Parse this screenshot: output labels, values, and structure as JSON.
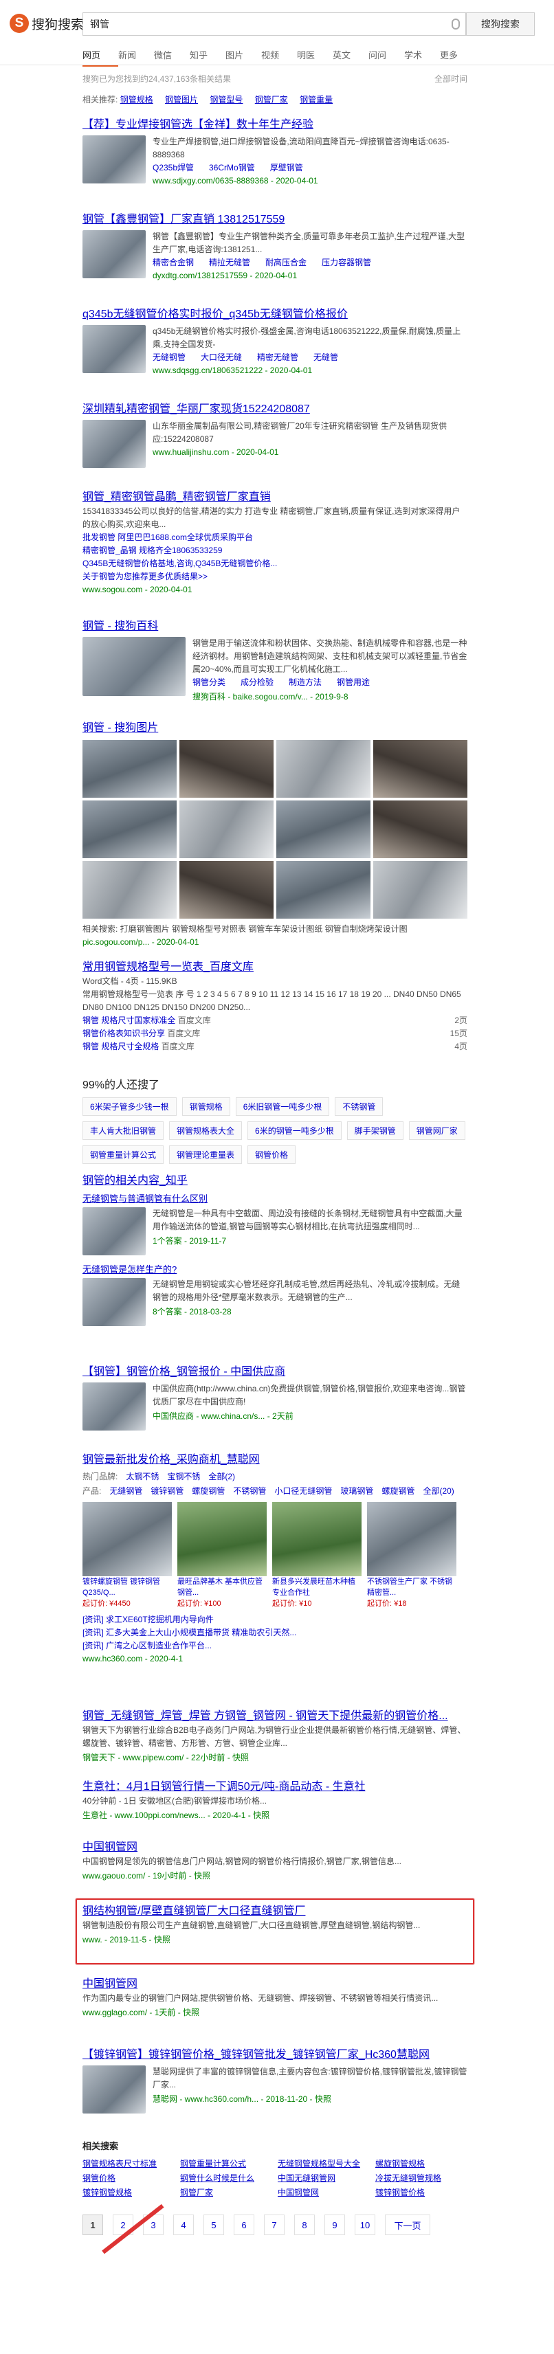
{
  "logo": {
    "mark": "S",
    "text": "搜狗搜索"
  },
  "search": {
    "value": "钢管",
    "button": "搜狗搜索"
  },
  "tabs": [
    "网页",
    "新闻",
    "微信",
    "知乎",
    "图片",
    "视频",
    "明医",
    "英文",
    "问问",
    "学术",
    "更多"
  ],
  "info": {
    "count": "搜狗已为您找到约24,437,163条相关结果",
    "tools": "全部时间"
  },
  "related_top": {
    "label": "相关推荐:",
    "items": [
      "钢管规格",
      "钢管图片",
      "钢管型号",
      "钢管厂家",
      "钢管重量"
    ]
  },
  "results": [
    {
      "title": "【荐】专业焊接钢管选【金祥】数十年生产经验",
      "text": "专业生产焊接钢管,进口焊接钢管设备,流动阳间直降百元~焊接钢管咨询电话:0635-8889368",
      "links": [
        "Q235b焊管",
        "36CrMo钢管",
        "厚壁钢管"
      ],
      "url": "www.sdjxgy.com/0635-8889368 - 2020-04-01"
    },
    {
      "title": "钢管【鑫豐钢管】厂家直销 13812517559",
      "text": "钢管【鑫豐钢管】专业生产钢管种类齐全,质量可靠多年老员工监护,生产过程严谨,大型生产厂家,电话咨询:1381251...",
      "links": [
        "精密合金钢",
        "精拉无缝管",
        "耐高压合金",
        "压力容器钢管"
      ],
      "url": "dyxdtg.com/13812517559 - 2020-04-01"
    },
    {
      "title": "q345b无缝钢管价格实时报价_q345b无缝钢管价格报价",
      "text": "q345b无缝钢管价格实时报价-强盛金属,咨询电话18063521222,质量保,耐腐蚀,质量上乘,支持全国发货-",
      "links": [
        "无缝钢管",
        "大口径无缝",
        "精密无缝管",
        "无缝管"
      ],
      "url": "www.sdqsgg.cn/18063521222 - 2020-04-01"
    },
    {
      "title": "深圳精轧精密钢管_华丽厂家现货15224208087",
      "text": "山东华丽金属制品有限公司,精密钢管厂20年专注研究精密钢管 生产及销售现货供应:15224208087",
      "url": "www.hualijinshu.com - 2020-04-01"
    }
  ],
  "sogou_result": {
    "title": "钢管_精密钢管晶鹏_精密钢管厂家直销",
    "text": "15341833345公司以良好的信誉,精湛的实力 打造专业 精密钢管,厂家直销,质量有保证,选到对家深得用户的放心购买,欢迎来电...",
    "lines": [
      "批发钢管 阿里巴巴1688.com全球优质采购平台",
      "精密钢管_晶钢 规格齐全18063533259",
      "Q345B无缝钢管价格基地,咨询,Q345B无缝钢管价格...",
      "关于钢管为您推荐更多优质结果>>"
    ],
    "url": "www.sogou.com - 2020-04-01"
  },
  "baike": {
    "title": "钢管 - 搜狗百科",
    "text": "钢管是用于输送流体和粉状固体、交换热能、制造机械零件和容器,也是一种经济钢材。用钢管制造建筑结构网架、支柱和机械支架可以减轻重量,节省金属20~40%,而且可实现工厂化机械化施工...",
    "links": [
      "钢管分类",
      "成分检验",
      "制造方法",
      "钢管用途"
    ],
    "url": "搜狗百科 - baike.sogou.com/v... - 2019-9-8"
  },
  "images": {
    "title": "钢管 - 搜狗图片",
    "related": "相关搜索: 打磨钢管图片  钢管规格型号对照表  钢管车车架设计图纸  钢管自制烧烤架设计图",
    "url": "pic.sogou.com/p... - 2020-04-01"
  },
  "wenku": {
    "title": "常用钢管规格型号一览表_百度文库",
    "meta": "Word文档 - 4页 - 115.9KB",
    "text": "常用钢管规格型号一览表 序 号 1 2 3 4 5 6 7 8 9 10 11 12 13 14 15 16 17 18 19 20 ... DN40 DN50 DN65 DN80 DN100 DN125 DN150 DN200 DN250...",
    "docs": [
      {
        "name": "钢管 规格尺寸国家标准全",
        "src": "百度文库",
        "pages": "2页"
      },
      {
        "name": "钢管价格表知识书分享",
        "src": "百度文库",
        "pages": "15页"
      },
      {
        "name": "钢管 规格尺寸全规格",
        "src": "百度文库",
        "pages": "4页"
      }
    ]
  },
  "also_ask": {
    "title": "99%的人还搜了",
    "items": [
      "6米架子管多少钱一根",
      "钢管规格",
      "6米旧钢管一吨多少根",
      "不锈钢管",
      "丰人肯大批旧钢管",
      "钢管规格表大全",
      "6米的钢管一吨多少根",
      "脚手架钢管",
      "钢管网厂家",
      "钢管重量计算公式",
      "钢管理论重量表",
      "钢管价格"
    ]
  },
  "zhihu": {
    "title": "钢管的相关内容_知乎",
    "q1": "无缝钢管与普通钢管有什么区别",
    "t1": "无缝钢管是一种具有中空截面、周边没有接缝的长条钢材,无缝钢管具有中空截面,大量用作输送流体的管道,钢管与圆钢等实心钢材相比,在抗弯抗扭强度相同时...",
    "m1": "1个答案 - 2019-11-7",
    "q2": "无缝钢管是怎样生产的?",
    "t2": "无缝钢管是用钢锭或实心管坯经穿孔制成毛管,然后再经热轧、冷轧或冷拔制成。无缝钢管的规格用外径*壁厚毫米数表示。无缝钢管的生产...",
    "m2": "8个答案 - 2018-03-28"
  },
  "china_cn": {
    "title": "【钢管】钢管价格_钢管报价 - 中国供应商",
    "text": "中国供应商(http://www.china.cn)免费提供钢管,钢管价格,钢管报价,欢迎来电咨询...钢管优质厂家尽在中国供应商!",
    "url": "中国供应商 - www.china.cn/s... - 2天前"
  },
  "hc360": {
    "title": "钢管最新批发价格_采购商机_慧聪网",
    "filter_label": "热门品牌:",
    "filter": [
      "太钢不锈",
      "宝钢不锈",
      "全部(2)"
    ],
    "filter2_label": "产品:",
    "filter2": [
      "无缝钢管",
      "镀锌钢管",
      "螺旋钢管",
      "不锈钢管",
      "小口径无缝钢管",
      "玻璃钢管",
      "螺旋钢管",
      "全部(20)"
    ],
    "products": [
      {
        "name": "镀锌螺旋钢管 镀锌钢管Q235/Q...",
        "price": "起订价: ¥4450"
      },
      {
        "name": "最旺品牌基木 基本供应管 钢管...",
        "price": "起订价: ¥100"
      },
      {
        "name": "新县多兴发晨旺苗木种植专业合作社",
        "price": "起订价: ¥10"
      },
      {
        "name": "不锈钢管生产厂家 不锈钢精密管...",
        "price": "起订价: ¥18"
      }
    ],
    "links": [
      "[资讯] 求工XE60T挖掘机用内导向件",
      "[资讯] 汇多大美金上大山小规模直播带货 精准助农引天然...",
      "[资讯] 广湾之心区制造业合作平台..."
    ],
    "url": "www.hc360.com - 2020-4-1"
  },
  "pipew": {
    "title": "钢管_无缝钢管_焊管_焊管 方钢管_钢管网 - 钢管天下提供最新的钢管价格...",
    "text": "钢管天下为钢管行业综合B2B电子商务门户网站,为钢管行业企业提供最新钢管价格行情,无缝钢管、焊管、螺旋管、镀锌管、精密管、方形管、方管、钢管企业库...",
    "url": "钢管天下 - www.pipew.com/ - 22小时前 - 快照"
  },
  "100ppi": {
    "title": "生意社：4月1日钢管行情一下调50元/吨-商品动态 - 生意社",
    "text": "40分钟前 - 1日 安徽地区(合肥)钢管焊接市场价格...",
    "url": "生意社 - www.100ppi.com/news... - 2020-4-1 - 快照"
  },
  "gaouo": {
    "title": "中国钢管网",
    "text": "中国钢管网是领先的钢管信息门户网站,钢管网的钢管价格行情报价,钢管厂家,钢管信息...",
    "url": "www.gaouo.com/ - 19小时前 - 快照"
  },
  "highlighted": {
    "title": "钢结构钢管/厚壁直缝钢管厂大口径直缝钢管厂",
    "text": "钢管制造股份有限公司生产直缝钢管,直缝钢管厂,大口径直缝钢管,厚壁直缝钢管,钢结构钢管...",
    "url": "www.      - 2019-11-5 - 快照"
  },
  "gglago": {
    "title": "中国钢管网",
    "text": "作为国内最专业的钢管门户网站,提供钢管价格、无缝钢管、焊接钢管、不锈钢管等相关行情资讯...",
    "url": "www.gglago.com/ - 1天前 - 快照"
  },
  "hc360b": {
    "title": "【镀锌钢管】镀锌钢管价格_镀锌钢管批发_镀锌钢管厂家_Hc360慧聪网",
    "text": "慧聪网提供了丰富的镀锌钢管信息,主要内容包含:镀锌钢管价格,镀锌钢管批发,镀锌钢管厂家...",
    "url": "慧聪网 - www.hc360.com/h... - 2018-11-20 - 快照"
  },
  "rel_search": {
    "title": "相关搜索",
    "items": [
      "钢管规格表尺寸标准",
      "钢管重量计算公式",
      "无缝钢管规格型号大全",
      "螺旋钢管规格",
      "钢管价格",
      "钢管什么时候是什么",
      "中国无缝钢管网",
      "冷拔无缝钢管规格",
      "镀锌钢管规格",
      "钢管厂家",
      "中国钢管网",
      "镀锌钢管价格"
    ]
  },
  "pager": {
    "pages": [
      "1",
      "2",
      "3",
      "4",
      "5",
      "6",
      "7",
      "8",
      "9",
      "10"
    ],
    "next": "下一页"
  }
}
